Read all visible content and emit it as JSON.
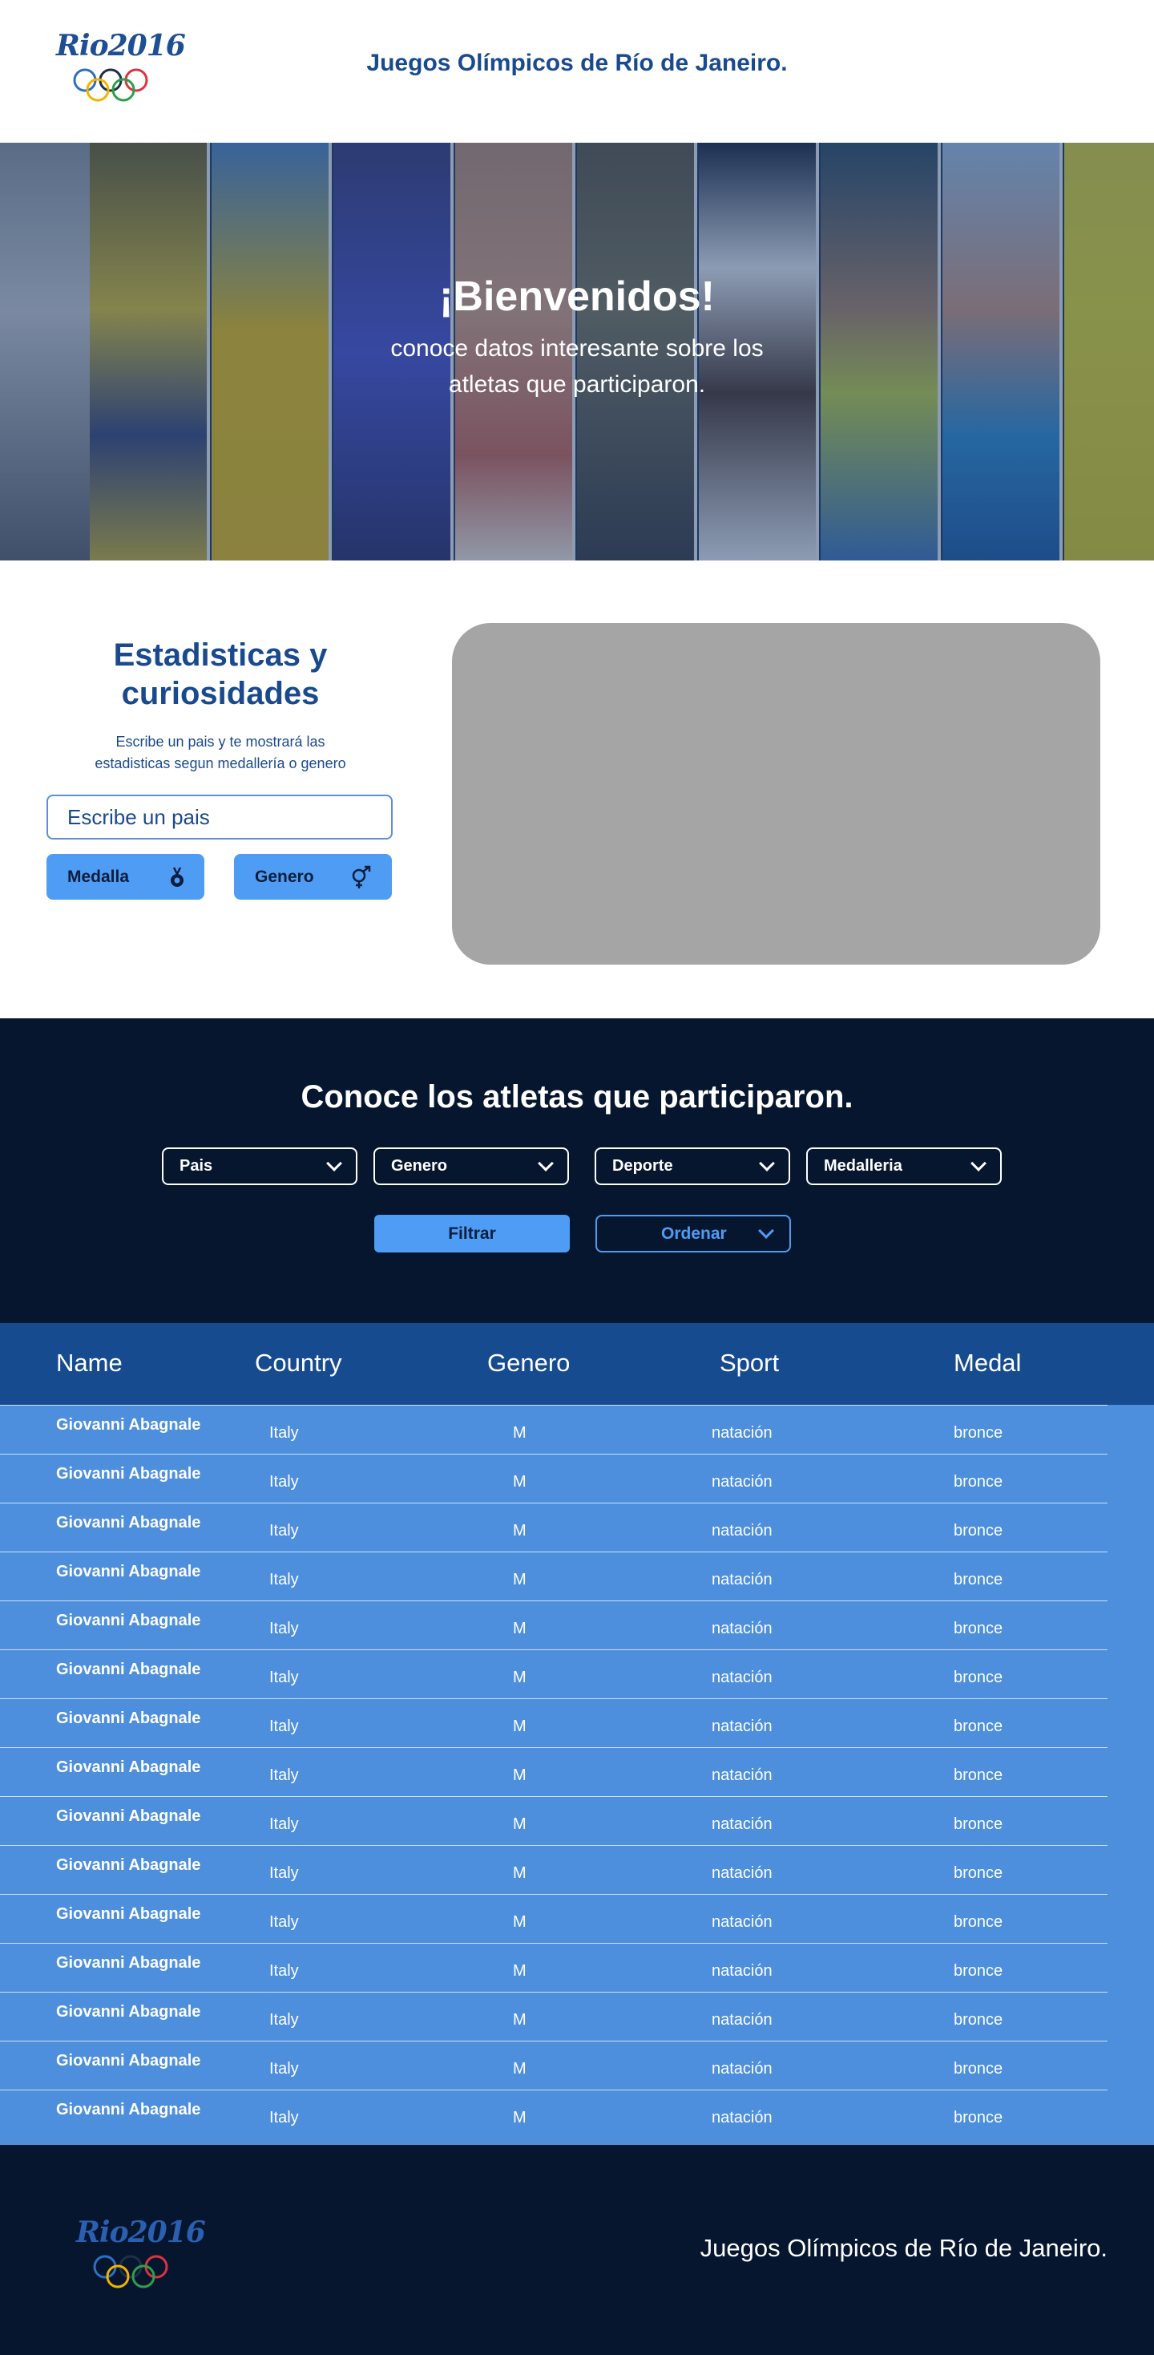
{
  "header": {
    "logo_text": "Rio2016",
    "title": "Juegos Olímpicos de Río de Janeiro."
  },
  "hero": {
    "title": "¡Bienvenidos!",
    "subtitle_line1": "conoce datos interesante sobre los",
    "subtitle_line2": "atletas que participaron."
  },
  "stats": {
    "title_line1": "Estadisticas  y",
    "title_line2": "curiosidades",
    "desc_line1": "Escribe un pais y te mostrará las",
    "desc_line2": "estadisticas segun medallería o genero",
    "input_placeholder": "Escribe un pais",
    "medal_button": "Medalla",
    "gender_button": "Genero"
  },
  "athletes": {
    "title": "Conoce los atletas que participaron.",
    "filters": [
      "Pais",
      "Genero",
      "Deporte",
      "Medalleria"
    ],
    "filter_button": "Filtrar",
    "order_button": "Ordenar"
  },
  "table": {
    "headers": [
      "Name",
      "Country",
      "Genero",
      "Sport",
      "Medal"
    ],
    "rows": [
      {
        "name": "Giovanni Abagnale",
        "country": "Italy",
        "gender": "M",
        "sport": "natación",
        "medal": "bronce"
      },
      {
        "name": "Giovanni Abagnale",
        "country": "Italy",
        "gender": "M",
        "sport": "natación",
        "medal": "bronce"
      },
      {
        "name": "Giovanni Abagnale",
        "country": "Italy",
        "gender": "M",
        "sport": "natación",
        "medal": "bronce"
      },
      {
        "name": "Giovanni Abagnale",
        "country": "Italy",
        "gender": "M",
        "sport": "natación",
        "medal": "bronce"
      },
      {
        "name": "Giovanni Abagnale",
        "country": "Italy",
        "gender": "M",
        "sport": "natación",
        "medal": "bronce"
      },
      {
        "name": "Giovanni Abagnale",
        "country": "Italy",
        "gender": "M",
        "sport": "natación",
        "medal": "bronce"
      },
      {
        "name": "Giovanni Abagnale",
        "country": "Italy",
        "gender": "M",
        "sport": "natación",
        "medal": "bronce"
      },
      {
        "name": "Giovanni Abagnale",
        "country": "Italy",
        "gender": "M",
        "sport": "natación",
        "medal": "bronce"
      },
      {
        "name": "Giovanni Abagnale",
        "country": "Italy",
        "gender": "M",
        "sport": "natación",
        "medal": "bronce"
      },
      {
        "name": "Giovanni Abagnale",
        "country": "Italy",
        "gender": "M",
        "sport": "natación",
        "medal": "bronce"
      },
      {
        "name": "Giovanni Abagnale",
        "country": "Italy",
        "gender": "M",
        "sport": "natación",
        "medal": "bronce"
      },
      {
        "name": "Giovanni Abagnale",
        "country": "Italy",
        "gender": "M",
        "sport": "natación",
        "medal": "bronce"
      },
      {
        "name": "Giovanni Abagnale",
        "country": "Italy",
        "gender": "M",
        "sport": "natación",
        "medal": "bronce"
      },
      {
        "name": "Giovanni Abagnale",
        "country": "Italy",
        "gender": "M",
        "sport": "natación",
        "medal": "bronce"
      },
      {
        "name": "Giovanni Abagnale",
        "country": "Italy",
        "gender": "M",
        "sport": "natación",
        "medal": "bronce"
      }
    ]
  },
  "footer": {
    "logo_text": "Rio2016",
    "text": "Juegos Olímpicos de Río de Janeiro."
  },
  "colors": {
    "brand_blue": "#1a4a8e",
    "accent_blue": "#4f9cf5",
    "dark_navy": "#07162f",
    "table_blue": "#4d8fdd",
    "table_header": "#174b90"
  }
}
